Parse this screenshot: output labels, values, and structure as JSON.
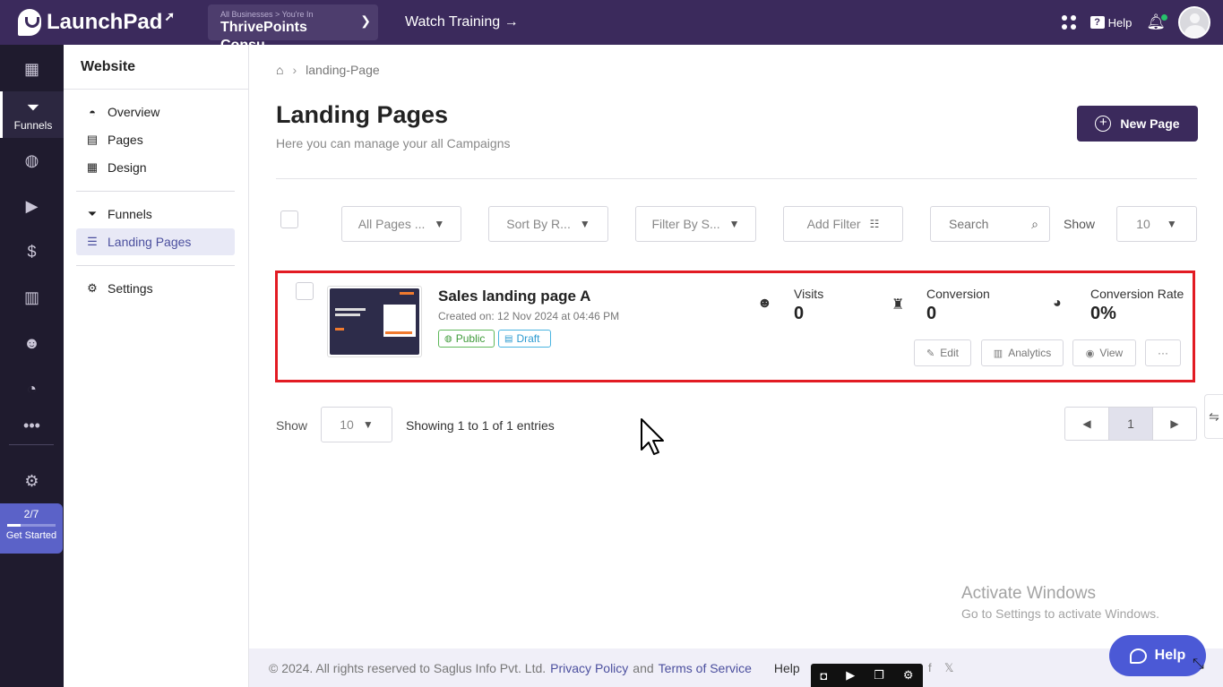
{
  "app": {
    "logo_text": "LaunchPad",
    "business_small": "All Businesses > You're In",
    "business_name": "ThrivePoints Consu...",
    "watch_training": "Watch Training →",
    "help_label": "Help",
    "help_q": "?"
  },
  "rail": {
    "funnels_label": "Funnels",
    "progress_count": "2/7",
    "progress_fraction": 0.285,
    "get_started": "Get Started"
  },
  "sub_sidebar": {
    "title": "Website",
    "items": [
      {
        "label": "Overview"
      },
      {
        "label": "Pages"
      },
      {
        "label": "Design"
      },
      {
        "label": "Funnels"
      },
      {
        "label": "Landing Pages"
      },
      {
        "label": "Settings"
      }
    ]
  },
  "breadcrumb": {
    "current": "landing-Page"
  },
  "header": {
    "title": "Landing Pages",
    "subtitle": "Here you can manage your all Campaigns",
    "new_button": "New Page"
  },
  "filters": {
    "all_pages": "All Pages ...",
    "sort_by": "Sort By R...",
    "filter_by": "Filter By S...",
    "add_filter": "Add Filter",
    "search_placeholder": "Search",
    "show_label": "Show",
    "show_value": "10"
  },
  "card": {
    "title": "Sales landing page A",
    "created": "Created on: 12 Nov 2024 at 04:46 PM",
    "badge_public": "Public",
    "badge_draft": "Draft",
    "visits_label": "Visits",
    "visits_value": "0",
    "conversion_label": "Conversion",
    "conversion_value": "0",
    "rate_label": "Conversion Rate",
    "rate_value": "0%",
    "edit": "Edit",
    "analytics": "Analytics",
    "view": "View",
    "more": "···"
  },
  "pagination": {
    "show_label": "Show",
    "show_value": "10",
    "entries": "Showing 1 to 1 of 1 entries",
    "prev": "◀",
    "current": "1",
    "next": "▶"
  },
  "watermark": {
    "line1": "Activate Windows",
    "line2": "Go to Settings to activate Windows."
  },
  "footer": {
    "copyright": "©  2024. All rights reserved to Saglus Info Pvt. Ltd.",
    "privacy": "Privacy Policy",
    "and": "and",
    "terms": "Terms of Service",
    "help": "Help",
    "facebook": "f",
    "x": "𝕏"
  },
  "help_float": {
    "label": "Help"
  },
  "colors": {
    "primary": "#3b2a5c",
    "rail": "#1f1b2e",
    "highlight_border": "#e21b23",
    "accent": "#4b59d6"
  }
}
